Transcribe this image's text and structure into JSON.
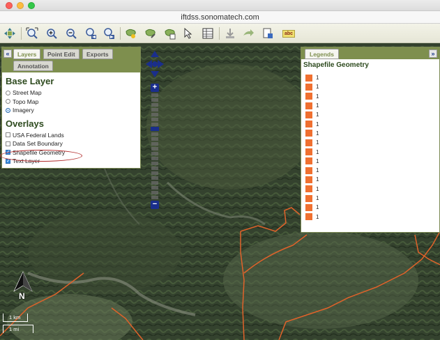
{
  "window": {
    "url": "iftdss.sonomatech.com"
  },
  "toolbar": {
    "icons": [
      "pan-icon",
      "zoom-extent-icon",
      "zoom-in-icon",
      "zoom-out-icon",
      "zoom-previous-icon",
      "zoom-next-icon",
      "add-polygon-icon",
      "edit-polygon-icon",
      "polygon-table-icon",
      "select-arrow-icon",
      "attribute-table-icon",
      "download-icon",
      "forward-icon",
      "print-icon",
      "label-abc-icon"
    ],
    "label_text": "abc"
  },
  "layers_panel": {
    "collapse_glyph": "«",
    "tabs": [
      "Layers",
      "Point Edit",
      "Exports",
      "Annotation"
    ],
    "base_layer_title": "Base Layer",
    "base_layers": [
      {
        "label": "Street Map",
        "selected": false
      },
      {
        "label": "Topo Map",
        "selected": false
      },
      {
        "label": "Imagery",
        "selected": true
      }
    ],
    "overlays_title": "Overlays",
    "overlays": [
      {
        "label": "USA Federal Lands",
        "checked": false
      },
      {
        "label": "Data Set Boundary",
        "checked": false
      },
      {
        "label": "Shapefile Geometry",
        "checked": true
      },
      {
        "label": "Text Layer",
        "checked": true
      }
    ]
  },
  "zoom": {
    "plus": "+",
    "minus": "−"
  },
  "legend_panel": {
    "tab": "Legends",
    "collapse_glyph": "»",
    "title": "Shapefile Geometry",
    "swatch_color": "#f07030",
    "items": [
      "1",
      "1",
      "1",
      "1",
      "1",
      "1",
      "1",
      "1",
      "1",
      "1",
      "1",
      "1",
      "1",
      "1",
      "1",
      "1"
    ]
  },
  "map": {
    "north_label": "N",
    "scale_km": "1 km",
    "scale_mi": "1 mi",
    "boundary_color": "#e0622a"
  }
}
